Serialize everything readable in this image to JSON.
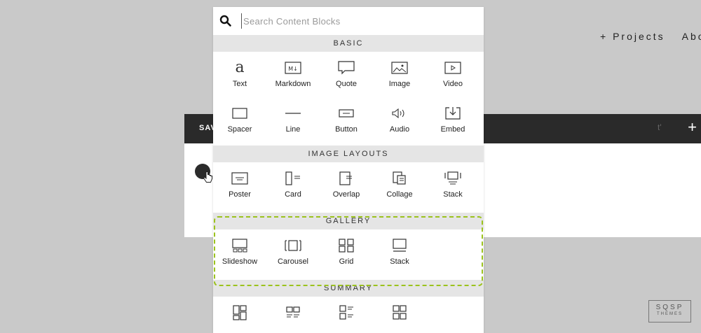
{
  "nav": {
    "projects": "+ Projects",
    "about": "Abo"
  },
  "editor": {
    "save_label": "SAV",
    "faint_text": "t'",
    "add_label": "+"
  },
  "picker": {
    "search_placeholder": "Search Content Blocks",
    "sections": {
      "basic": {
        "title": "BASIC",
        "items": [
          {
            "label": "Text",
            "icon": "text-icon"
          },
          {
            "label": "Markdown",
            "icon": "markdown-icon"
          },
          {
            "label": "Quote",
            "icon": "quote-icon"
          },
          {
            "label": "Image",
            "icon": "image-icon"
          },
          {
            "label": "Video",
            "icon": "video-icon"
          },
          {
            "label": "Spacer",
            "icon": "spacer-icon"
          },
          {
            "label": "Line",
            "icon": "line-icon"
          },
          {
            "label": "Button",
            "icon": "button-icon"
          },
          {
            "label": "Audio",
            "icon": "audio-icon"
          },
          {
            "label": "Embed",
            "icon": "embed-icon"
          }
        ]
      },
      "image_layouts": {
        "title": "IMAGE LAYOUTS",
        "items": [
          {
            "label": "Poster",
            "icon": "poster-icon"
          },
          {
            "label": "Card",
            "icon": "card-icon"
          },
          {
            "label": "Overlap",
            "icon": "overlap-icon"
          },
          {
            "label": "Collage",
            "icon": "collage-icon"
          },
          {
            "label": "Stack",
            "icon": "stack-icon"
          }
        ]
      },
      "gallery": {
        "title": "GALLERY",
        "items": [
          {
            "label": "Slideshow",
            "icon": "slideshow-icon"
          },
          {
            "label": "Carousel",
            "icon": "carousel-icon"
          },
          {
            "label": "Grid",
            "icon": "grid-icon"
          },
          {
            "label": "Stack",
            "icon": "gallery-stack-icon"
          }
        ]
      },
      "summary": {
        "title": "SUMMARY",
        "items": [
          {
            "icon": "summary-wall-icon"
          },
          {
            "icon": "summary-list-icon"
          },
          {
            "icon": "summary-grid-icon"
          },
          {
            "icon": "summary-carousel-icon"
          }
        ]
      }
    }
  },
  "badge": {
    "line1": "SQSP",
    "line2": "THEMES"
  },
  "colors": {
    "highlight_outline": "#9bc21d",
    "editor_bar": "#2a2a2a",
    "background": "#c9c9c9"
  }
}
